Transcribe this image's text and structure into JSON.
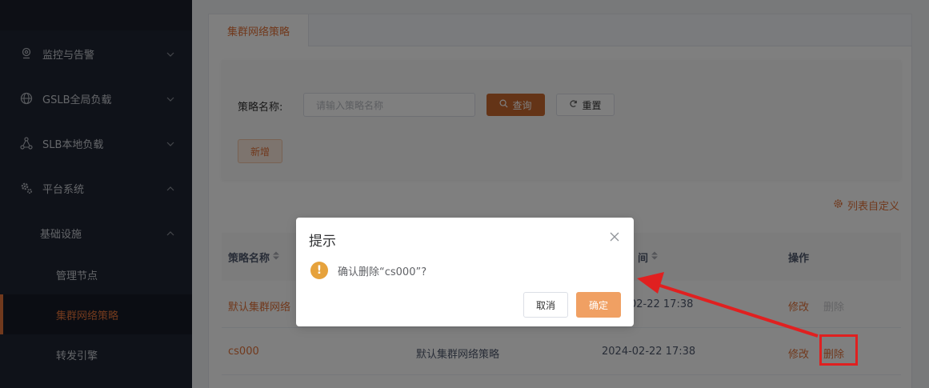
{
  "sidebar": {
    "items": [
      {
        "label": "监控与告警",
        "icon": "location-pin-icon"
      },
      {
        "label": "GSLB全局负载",
        "icon": "globe-icon"
      },
      {
        "label": "SLB本地负载",
        "icon": "network-nodes-icon"
      },
      {
        "label": "平台系统",
        "icon": "gear-icon"
      }
    ],
    "group": {
      "label": "基础设施"
    },
    "sub_items": [
      {
        "label": "管理节点"
      },
      {
        "label": "集群网络策略"
      },
      {
        "label": "转发引擎"
      }
    ]
  },
  "tab": {
    "label": "集群网络策略"
  },
  "search": {
    "label": "策略名称:",
    "placeholder": "请输入策略名称",
    "query_label": "查询",
    "reset_label": "重置",
    "add_label": "新增"
  },
  "column_custom_label": "列表自定义",
  "table": {
    "headers": [
      "策略名称",
      "间",
      "操作"
    ],
    "rows": [
      {
        "name": "默认集群网络",
        "time": "02-22 17:38",
        "edit": "修改",
        "delete": "删除"
      },
      {
        "name": "cs000",
        "policy": "默认集群网络策略",
        "time": "2024-02-22 17:38",
        "edit": "修改",
        "delete": "删除"
      }
    ]
  },
  "dialog": {
    "title": "提示",
    "message": "确认删除“cs000”?",
    "cancel_label": "取消",
    "confirm_label": "确定"
  },
  "colors": {
    "accent": "#e2733a",
    "sidebar_bg": "#1f2533",
    "annotation": "#e02020",
    "warning": "#e6a23c"
  }
}
